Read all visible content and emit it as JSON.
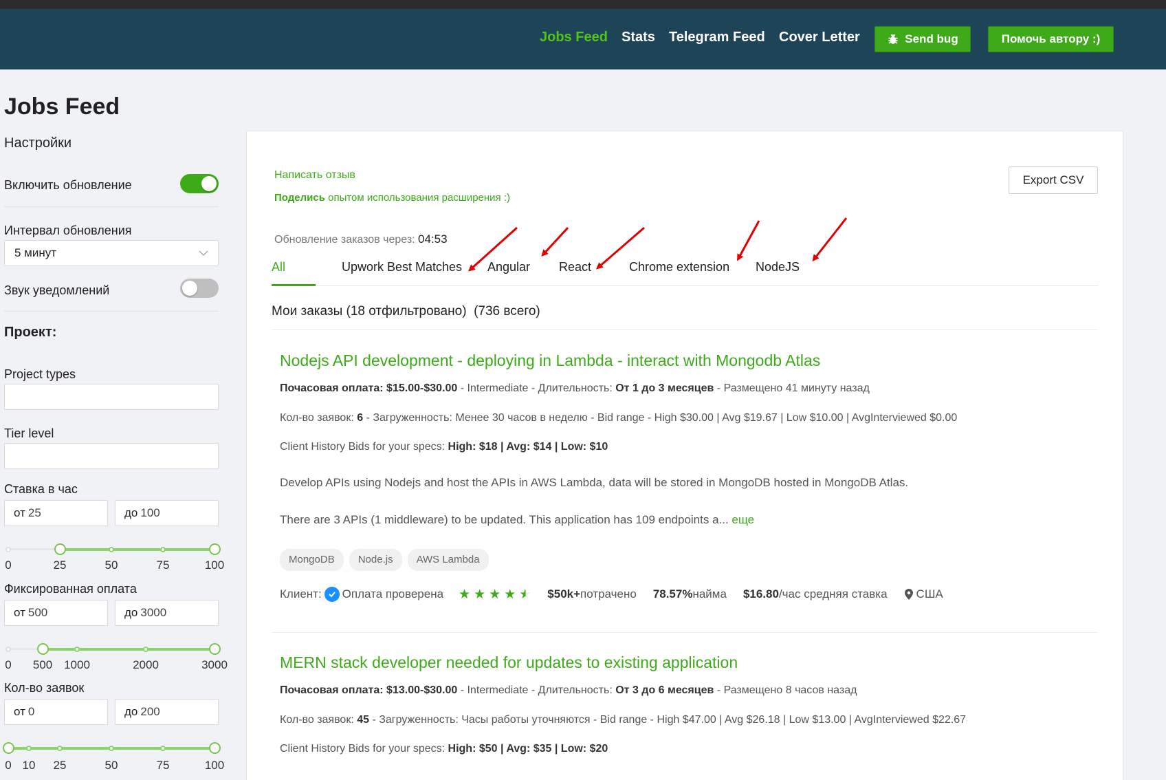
{
  "header": {
    "nav": [
      "Jobs Feed",
      "Stats",
      "Telegram Feed",
      "Cover Letter"
    ],
    "send_bug": "Send bug",
    "help_author": "Помочь автору :)"
  },
  "page_title": "Jobs Feed",
  "sidebar": {
    "settings": "Настройки",
    "enable_refresh": "Включить обновление",
    "refresh_interval_label": "Интервал обновления",
    "refresh_interval_value": "5 минут",
    "sound_label": "Звук уведомлений",
    "project_title": "Проект:",
    "project_types": "Project types",
    "tier_level": "Tier level",
    "hourly": {
      "label": "Ставка в час",
      "from_prefix": "от",
      "from": "25",
      "to_prefix": "до",
      "to": "100",
      "marks": [
        "0",
        "25",
        "50",
        "75",
        "100"
      ]
    },
    "fixed": {
      "label": "Фиксированная оплата",
      "from_prefix": "от",
      "from": "500",
      "to_prefix": "до",
      "to": "3000",
      "marks": [
        "0",
        "500",
        "1000",
        "2000",
        "3000"
      ]
    },
    "proposals": {
      "label": "Кол-во заявок",
      "from_prefix": "от",
      "from": "0",
      "to_prefix": "до",
      "to": "200",
      "marks": [
        "0",
        "10",
        "25",
        "50",
        "75",
        "100"
      ]
    }
  },
  "main": {
    "feedback_link": "Написать отзыв",
    "share_bold": "Поделись",
    "share_rest": " опытом использования расширения :)",
    "export": "Export CSV",
    "refresh_label": "Обновление заказов через: ",
    "refresh_timer": "04:53",
    "tabs": [
      "All",
      "Upwork Best Matches",
      "Angular",
      "React",
      "Chrome extension",
      "NodeJS"
    ],
    "count": "Мои заказы (18 отфильтровано)  (736 всего)"
  },
  "jobs": [
    {
      "title": "Nodejs API development - deploying in Lambda - interact with Mongodb Atlas",
      "rate_label": "Почасовая оплата: $15.00-$30.00",
      "level": " - Intermediate - Длительность: ",
      "duration": "От 1 до 3 месяцев",
      "posted": " - Размещено 41 минуту назад",
      "proposals_label": "Кол-во заявок: ",
      "proposals": "6",
      "load": " - Загруженность: Менее 30 часов в неделю - Bid range - High $30.00 | Avg $19.67 | Low $10.00 | AvgInterviewed $0.00",
      "history_label": "Client History Bids for your specs: ",
      "history": "High: $18 | Avg: $14 | Low: $10",
      "desc1": "Develop APIs using Nodejs and host the APIs in AWS Lambda, data will be stored in MongoDB hosted in MongoDB Atlas.",
      "desc2": "There are 3 APIs (1 middleware) to be updated. This application has 109 endpoints a... ",
      "more": "еще",
      "tags": [
        "MongoDB",
        "Node.js",
        "AWS Lambda"
      ],
      "client_label": "Клиент:",
      "verified": "Оплата проверена",
      "spent_bold": "$50k+",
      "spent": " потрачено",
      "hire_bold": "78.57%",
      "hire": " найма",
      "avg_bold": "$16.80",
      "avg": "/час средняя ставка",
      "country": "США"
    },
    {
      "title": "MERN stack developer needed for updates to existing application",
      "rate_label": "Почасовая оплата: $13.00-$30.00",
      "level": " - Intermediate - Длительность: ",
      "duration": "От 3 до 6 месяцев",
      "posted": " - Размещено 8 часов назад",
      "proposals_label": "Кол-во заявок: ",
      "proposals": "45",
      "load": " - Загруженность: Часы работы уточняются - Bid range - High $47.00 | Avg $26.18 | Low $13.00 | AvgInterviewed $22.67",
      "history_label": "Client History Bids for your specs: ",
      "history": "High: $50 | Avg: $35 | Low: $20"
    }
  ],
  "colors": {
    "header_bg": "#1e4457",
    "accent": "#3eaa1a",
    "arrow": "#e00000",
    "verified": "#1890ff"
  }
}
